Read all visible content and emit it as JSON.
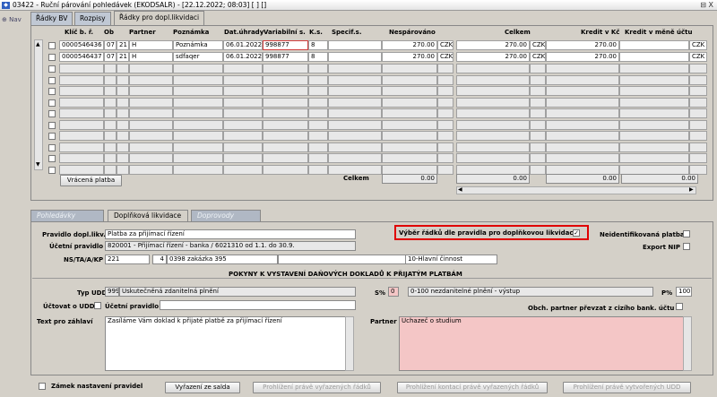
{
  "window": {
    "title": "03422 - Ruční párování pohledávek (EKODSALR) - [22.12.2022; 08:03] [ ] []",
    "buttons": "⊟ X"
  },
  "nav": {
    "label": "Nav"
  },
  "tabs": [
    "Řádky BV",
    "Rozpisy",
    "Řádky pro dopl.likvidaci"
  ],
  "grid": {
    "headers": [
      "Klíč b. ř.",
      "Ob",
      "Partner",
      "Poznámka",
      "Dat.úhrady",
      "Variabilní s.",
      "K.s.",
      "Specif.s.",
      "Nespárováno",
      "Celkem",
      "Kredit v Kč",
      "Kredit v měně účtu"
    ],
    "rows": [
      {
        "klic": "0000546436",
        "a": "07",
        "b": "21",
        "partner": "H",
        "poznamka": "Poznámka",
        "datum": "06.01.2022",
        "vs": "998877",
        "ks": "8",
        "nesparovano": "270.00",
        "mena1": "CZK",
        "celkem": "270.00",
        "mena2": "CZK",
        "kredit": "270.00",
        "mena3": "CZK"
      },
      {
        "klic": "0000546437",
        "a": "07",
        "b": "21",
        "partner": "H",
        "poznamka": "sdfaqer",
        "datum": "06.01.2022",
        "vs": "998877",
        "ks": "8",
        "nesparovano": "270.00",
        "mena1": "CZK",
        "celkem": "270.00",
        "mena2": "CZK",
        "kredit": "270.00",
        "mena3": "CZK"
      }
    ],
    "footer": {
      "button": "Vrácená platba",
      "celkem_label": "Celkem",
      "nesparovano": "0.00",
      "celkem": "0.00",
      "kredit": "0.00",
      "kredit_mena": "0.00"
    }
  },
  "subtabs": [
    "Pohledávky",
    "Doplňková likvidace",
    "Doprovody"
  ],
  "form": {
    "pravidlo_label": "Pravidlo dopl.likv.",
    "pravidlo_value": "Platba za přijímací řízení",
    "vyber_label": "Výběr řádků dle pravidla pro doplňkovou likvidaci",
    "vyber_checked": "✓",
    "neid_label": "Neidentifikovaná platba",
    "ucetni_label": "Účetní pravidlo",
    "ucetni_value": "820001 - Přijímací řízení - banka / 6021310 od 1.1. do 30.9.",
    "export_label": "Export NIP",
    "ns_label": "NS/TA/A/KP",
    "ns1": "221",
    "ns2": "4",
    "ns3": "0398 zakázka 395",
    "ns4": "10-Hlavní činnost",
    "section_title": "POKYNY K VYSTAVENÍ DAŇOVÝCH DOKLADŮ K PŘIJATÝM PLATBÁM",
    "typ_label": "Typ UDD",
    "typ_code": "999",
    "typ_value": "Uskutečněná zdanitelná plnění",
    "s_label": "S%",
    "s_value": "0",
    "s_text": "0-100 nezdanitelné plnění - výstup",
    "p_label": "P%",
    "p_value": "100",
    "uctovat_label": "Účtovat o UDD",
    "ucetni2_label": "Účetní pravidlo",
    "obch_label": "Obch. partner převzat z cizího bank. účtu",
    "text_label": "Text pro záhlaví",
    "text_value": "Zasíláme Vám doklad k přijaté platbě za přijímací řízení",
    "partner_label": "Partner",
    "partner_value": "Uchazeč o studium"
  },
  "bottom": {
    "zamek_label": "Zámek nastavení pravidel",
    "btn1": "Vyřazení ze salda",
    "btn2": "Prohlížení právě vyřazených řádků",
    "btn3": "Prohlížení kontací právě vyřazených řádků",
    "btn4": "Prohlížení právě vytvořených UDD"
  },
  "colors": {
    "highlight": "#e00000",
    "pink": "#f4c6c6",
    "selected_cell_border": "#d04040"
  }
}
